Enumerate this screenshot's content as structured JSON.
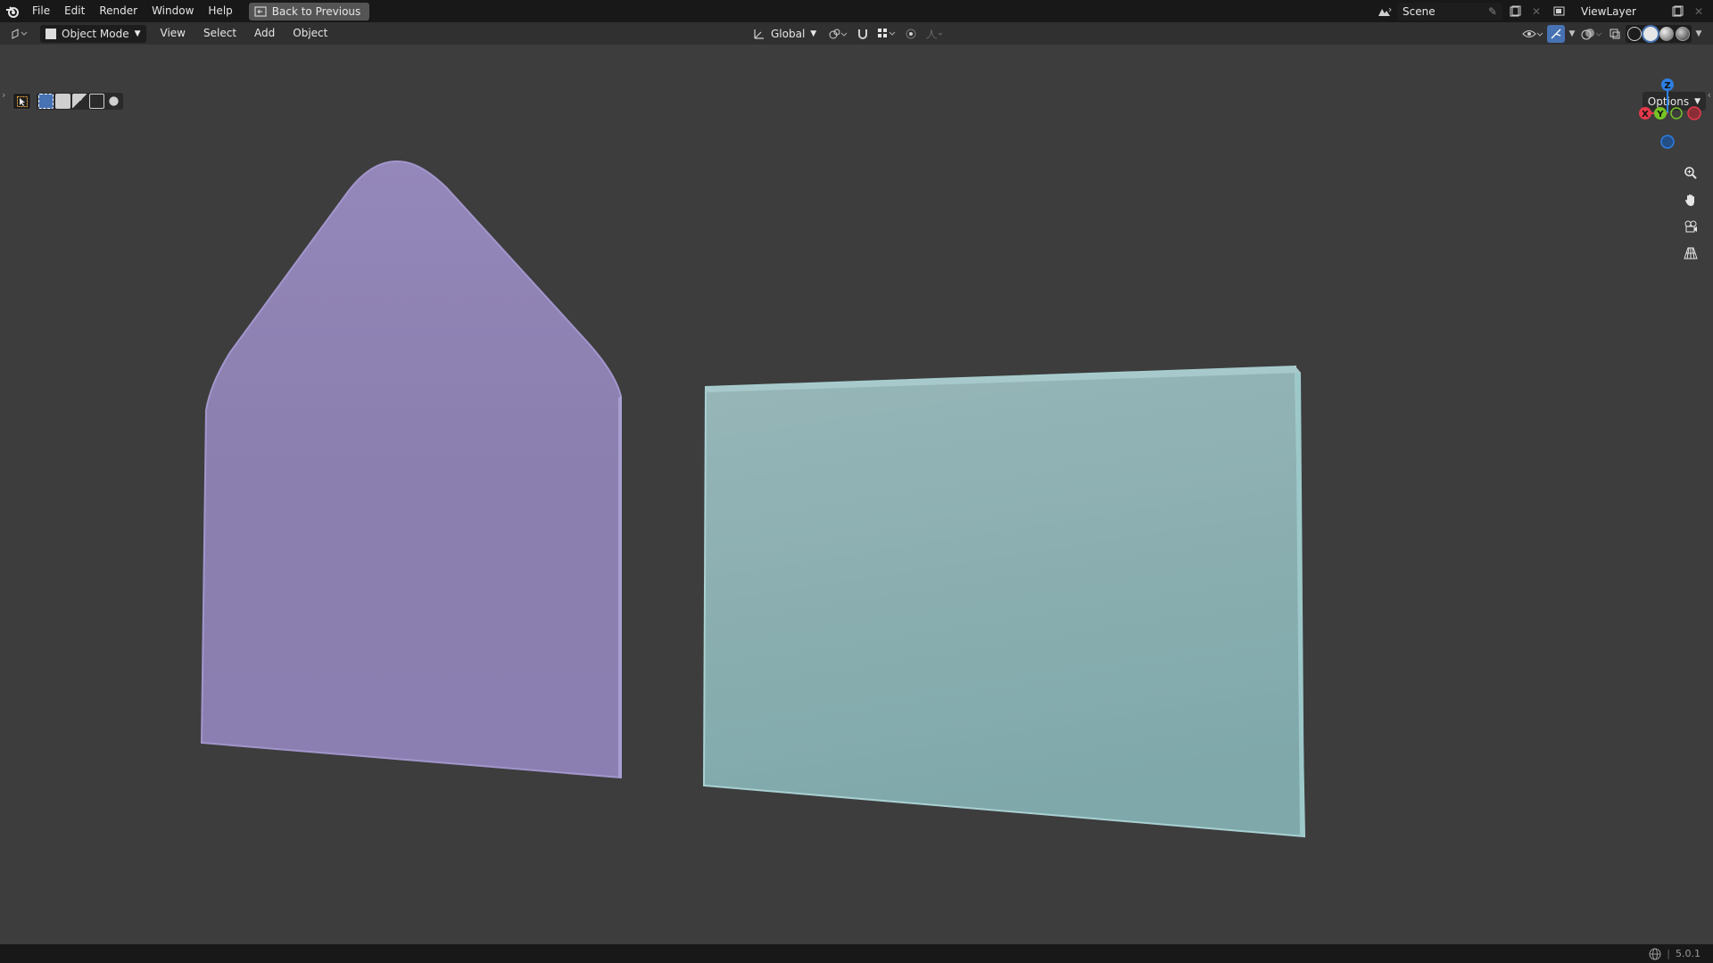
{
  "topbar": {
    "menus": [
      "File",
      "Edit",
      "Render",
      "Window",
      "Help"
    ],
    "back_button": "Back to Previous",
    "scene": "Scene",
    "view_layer": "ViewLayer"
  },
  "header": {
    "mode": "Object Mode",
    "menus": [
      "View",
      "Select",
      "Add",
      "Object"
    ],
    "transform_orientation": "Global"
  },
  "viewport": {
    "options_label": "Options",
    "gizmo": {
      "x_label": "X",
      "y_label": "Y",
      "z_label": "Z"
    },
    "objects": [
      {
        "name": "envelope-flap-plane",
        "color": "#8b7fb0"
      },
      {
        "name": "rectangle-plane",
        "color": "#8ab0b2"
      }
    ]
  },
  "statusbar": {
    "version": "5.0.1"
  },
  "colors": {
    "background": "#3d3d3d",
    "header": "#303030",
    "topbar": "#181818",
    "accent_blue": "#4772b3",
    "axis_x": "#e5394b",
    "axis_y": "#76c424",
    "axis_z": "#2d7fe3"
  }
}
